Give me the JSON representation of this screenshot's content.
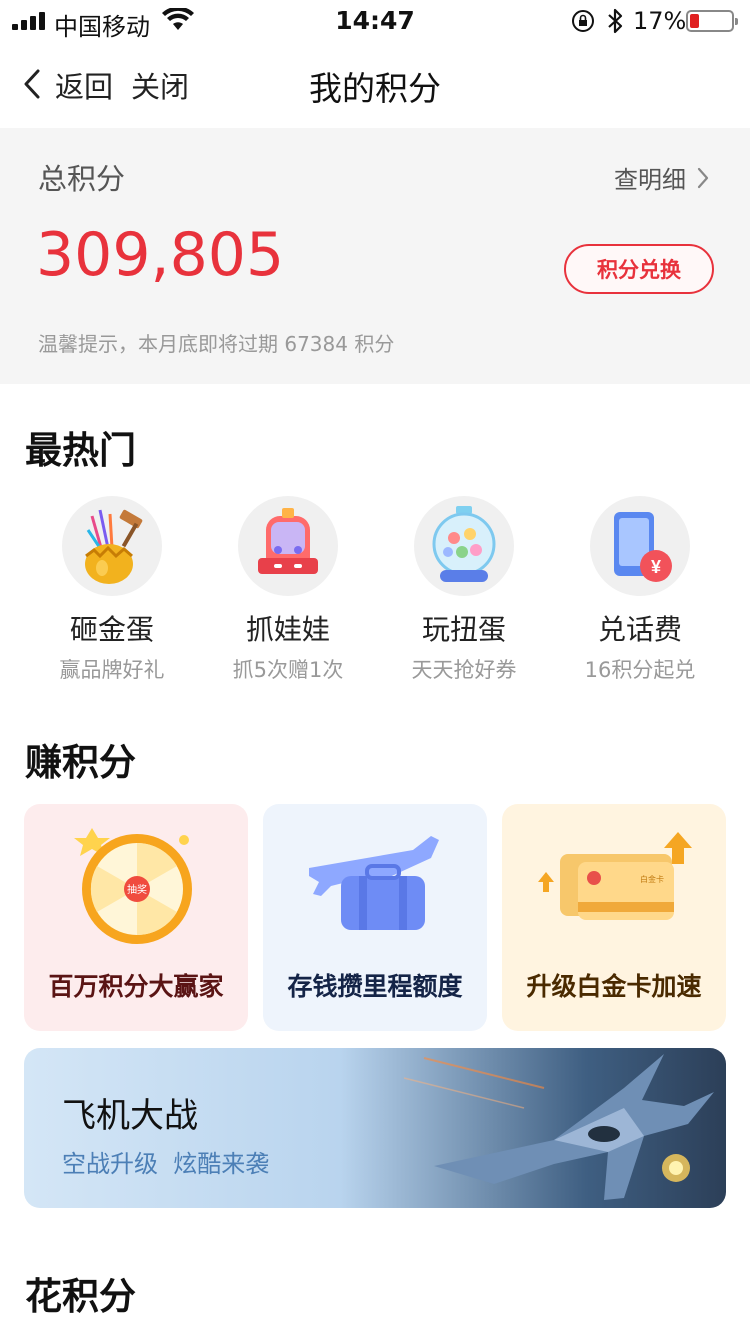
{
  "status_bar": {
    "carrier": "中国移动",
    "time": "14:47",
    "battery": "17%"
  },
  "nav": {
    "back": "返回",
    "close": "关闭",
    "title": "我的积分"
  },
  "points": {
    "label": "总积分",
    "detail": "查明细",
    "value": "309,805",
    "exchange": "积分兑换",
    "hint": "温馨提示，本月底即将过期 67384 积分"
  },
  "hot": {
    "title": "最热门",
    "items": [
      {
        "name": "砸金蛋",
        "sub": "赢品牌好礼",
        "icon": "golden-egg-icon"
      },
      {
        "name": "抓娃娃",
        "sub": "抓5次赠1次",
        "icon": "claw-machine-icon"
      },
      {
        "name": "玩扭蛋",
        "sub": "天天抢好券",
        "icon": "gashapon-icon"
      },
      {
        "name": "兑话费",
        "sub": "16积分起兑",
        "icon": "phone-bill-icon"
      }
    ]
  },
  "earn": {
    "title": "赚积分",
    "cards": [
      {
        "label": "百万积分大赢家",
        "color": "#5a1414",
        "bg": "#fdeced"
      },
      {
        "label": "存钱攒里程额度",
        "color": "#142447",
        "bg": "#eef4fc"
      },
      {
        "label": "升级白金卡加速",
        "color": "#4a2a00",
        "bg": "#fff4e0"
      }
    ],
    "wheel_center": "抽奖",
    "card_tag": "白金卡"
  },
  "banner": {
    "title": "飞机大战",
    "subtitle": "空战升级  炫酷来袭"
  },
  "spend": {
    "title": "花积分"
  },
  "colors": {
    "accent": "#e8323c"
  }
}
